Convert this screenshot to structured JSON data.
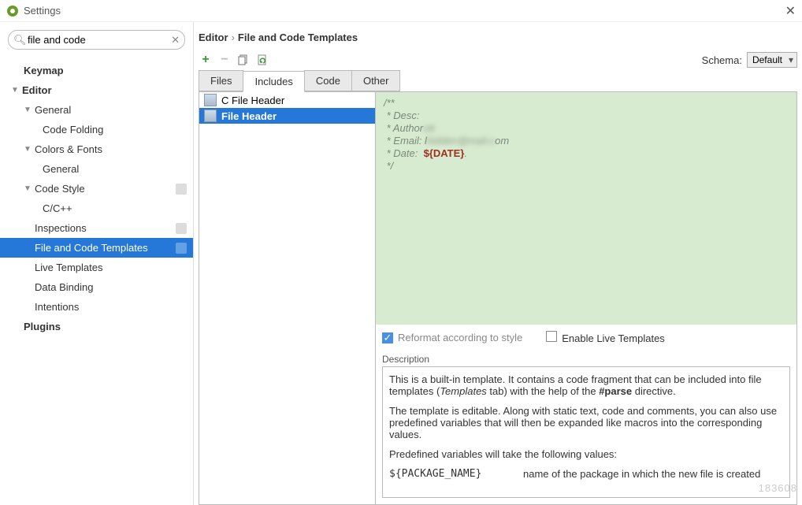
{
  "window": {
    "title": "Settings"
  },
  "search": {
    "value": "file and code"
  },
  "tree": {
    "keymap": "Keymap",
    "editor": "Editor",
    "general": "General",
    "code_folding": "Code Folding",
    "colors_fonts": "Colors & Fonts",
    "cf_general": "General",
    "code_style": "Code Style",
    "c_cpp": "C/C++",
    "inspections": "Inspections",
    "file_and_code": "File and Code Templates",
    "live_templates": "Live Templates",
    "data_binding": "Data Binding",
    "intentions": "Intentions",
    "plugins": "Plugins"
  },
  "breadcrumb": {
    "a": "Editor",
    "b": "File and Code Templates"
  },
  "schema": {
    "label": "Schema:",
    "value": "Default"
  },
  "tabs": [
    "Files",
    "Includes",
    "Code",
    "Other"
  ],
  "active_tab": 1,
  "template_list": [
    "C File Header",
    "File Header"
  ],
  "selected_template": 1,
  "editor_text": {
    "l1": "/**",
    "l2": " * Desc:",
    "l3": " * Author",
    "l4a": " * Email: l",
    "l4b": "om",
    "l5a": " * Date:  ",
    "l5b": "${DATE}",
    "l5c": ".",
    "l6": " */"
  },
  "options": {
    "reformat": "Reformat according to style",
    "live": "Enable Live Templates"
  },
  "desc": {
    "label": "Description",
    "p1a": "This is a built-in template. It contains a code fragment that can be included into file templates (",
    "p1b": "Templates",
    "p1c": " tab) with the help of the ",
    "p1d": "#parse",
    "p1e": " directive.",
    "p2": "The template is editable. Along with static text, code and comments, you can also use predefined variables that will then be expanded like macros into the corresponding values.",
    "p3": "Predefined variables will take the following values:",
    "var_k": "${PACKAGE_NAME}",
    "var_v": "name of the package in which the new file is created"
  },
  "watermark": "183608"
}
